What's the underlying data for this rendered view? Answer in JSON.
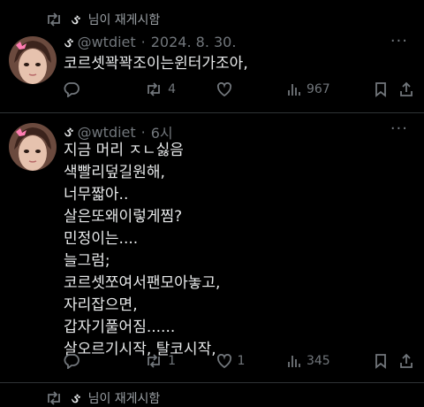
{
  "top_repost": {
    "icon": "repost-icon",
    "text": "님이 재게시함"
  },
  "tweet1": {
    "handle": "@wtdiet",
    "separator": "·",
    "time": "2024. 8. 30.",
    "more": "···",
    "lines": [
      "코르셋꽉꽉조이는윈터가조아,"
    ],
    "actions": {
      "reply": "",
      "repost": "4",
      "like": "",
      "views": "967"
    }
  },
  "tweet2": {
    "handle": "@wtdiet",
    "separator": "·",
    "time": "6시",
    "more": "···",
    "lines": [
      "지금 머리 ㅈㄴ싫음",
      "색빨리덮길원해,",
      "너무짧아..",
      "살은또왜이렇게찜?",
      "민정이는....",
      "늘그럼;",
      "코르셋쪼여서팬모아놓고,",
      "자리잡으면,",
      "갑자기풀어짐......",
      "살오르기시작, 탈코시작,"
    ],
    "actions": {
      "reply": "",
      "repost": "1",
      "like": "1",
      "views": "345"
    }
  },
  "bottom_repost": {
    "icon": "repost-icon",
    "text": "님이 재게시함"
  }
}
